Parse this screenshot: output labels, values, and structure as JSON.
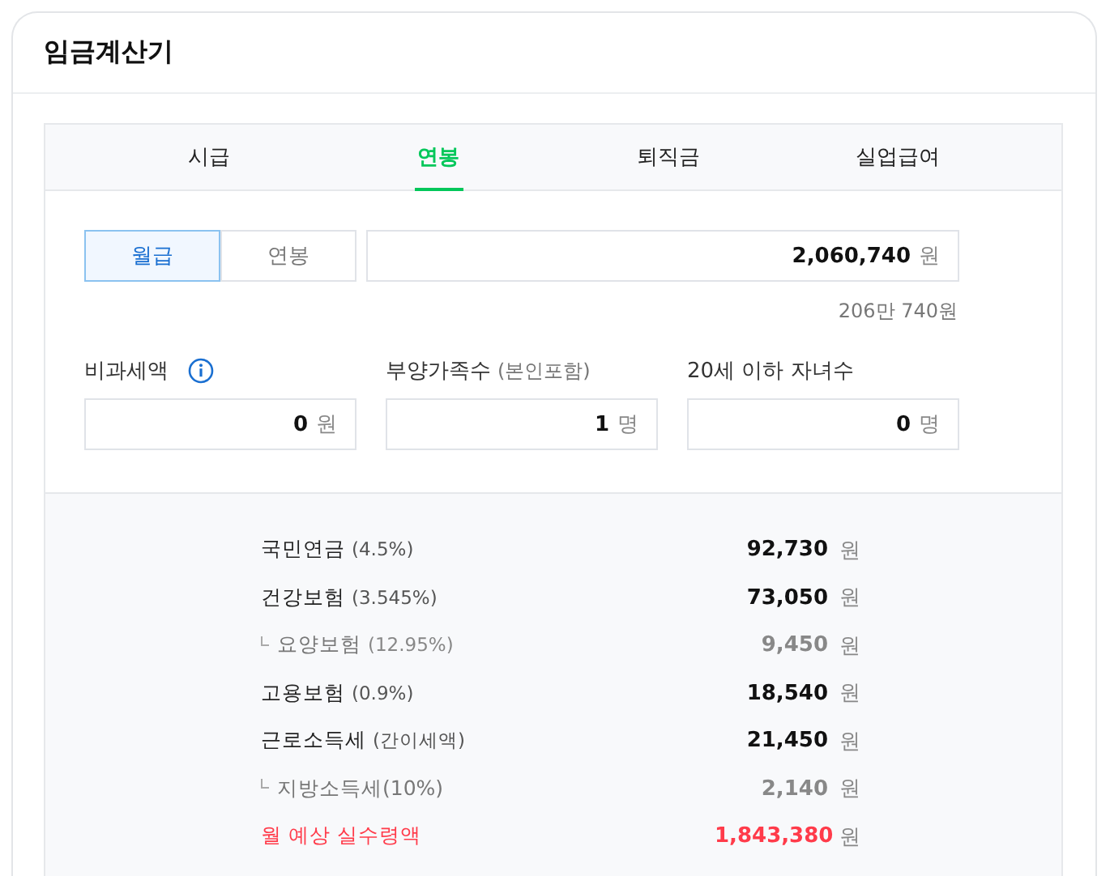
{
  "title": "임금계산기",
  "tabs": [
    {
      "label": "시급",
      "selected": false
    },
    {
      "label": "연봉",
      "selected": true
    },
    {
      "label": "퇴직금",
      "selected": false
    },
    {
      "label": "실업급여",
      "selected": false
    }
  ],
  "pay_types": [
    {
      "label": "월급",
      "selected": true
    },
    {
      "label": "연봉",
      "selected": false
    }
  ],
  "salary": {
    "value": "2,060,740",
    "unit": "원",
    "readout": "206만 740원"
  },
  "fields": [
    {
      "label": "비과세액",
      "info": true,
      "value": "0",
      "unit": "원"
    },
    {
      "label": "부양가족수",
      "note": "(본인포함)",
      "value": "1",
      "unit": "명"
    },
    {
      "label": "20세 이하 자녀수",
      "value": "0",
      "unit": "명"
    }
  ],
  "deductions": [
    {
      "kind": "main",
      "label": "국민연금",
      "note": "(4.5%)",
      "value": "92,730",
      "unit": "원"
    },
    {
      "kind": "main",
      "label": "건강보험",
      "note": "(3.545%)",
      "value": "73,050",
      "unit": "원"
    },
    {
      "kind": "sub",
      "label": "요양보험",
      "note": "(12.95%)",
      "value": "9,450",
      "unit": "원"
    },
    {
      "kind": "main",
      "label": "고용보험",
      "note": "(0.9%)",
      "value": "18,540",
      "unit": "원"
    },
    {
      "kind": "main",
      "label": "근로소득세",
      "note": "(간이세액)",
      "value": "21,450",
      "unit": "원"
    },
    {
      "kind": "sub",
      "label": "지방소득세(10%)",
      "value": "2,140",
      "unit": "원"
    },
    {
      "kind": "total",
      "label": "월 예상 실수령액",
      "value": "1,843,380",
      "unit": "원"
    }
  ]
}
